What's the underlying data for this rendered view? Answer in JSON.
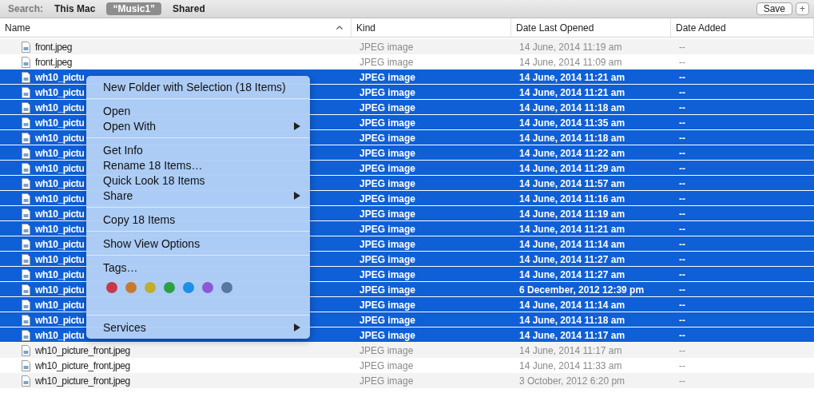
{
  "search_bar": {
    "label": "Search:",
    "scopes": [
      {
        "label": "This Mac",
        "selected": false
      },
      {
        "label": "“Music1”",
        "selected": true
      },
      {
        "label": "Shared",
        "selected": false
      }
    ],
    "save_button": "Save",
    "add_button": "+"
  },
  "table": {
    "columns": [
      {
        "label": "Name",
        "sorted": true
      },
      {
        "label": "Kind",
        "sorted": false
      },
      {
        "label": "Date Last Opened",
        "sorted": false
      },
      {
        "label": "Date Added",
        "sorted": false
      }
    ],
    "rows": [
      {
        "name": "front.jpeg",
        "kind": "JPEG image",
        "date_last_opened": "14 June, 2014 11:19 am",
        "date_added": "--",
        "selected": false
      },
      {
        "name": "front.jpeg",
        "kind": "JPEG image",
        "date_last_opened": "14 June, 2014 11:09 am",
        "date_added": "--",
        "selected": false
      },
      {
        "name": "wh10_pictu",
        "kind": "JPEG image",
        "date_last_opened": "14 June, 2014 11:21 am",
        "date_added": "--",
        "selected": true
      },
      {
        "name": "wh10_pictu",
        "kind": "JPEG image",
        "date_last_opened": "14 June, 2014 11:21 am",
        "date_added": "--",
        "selected": true
      },
      {
        "name": "wh10_pictu",
        "kind": "JPEG image",
        "date_last_opened": "14 June, 2014 11:18 am",
        "date_added": "--",
        "selected": true
      },
      {
        "name": "wh10_pictu",
        "kind": "JPEG image",
        "date_last_opened": "14 June, 2014 11:35 am",
        "date_added": "--",
        "selected": true
      },
      {
        "name": "wh10_pictu",
        "kind": "JPEG image",
        "date_last_opened": "14 June, 2014 11:18 am",
        "date_added": "--",
        "selected": true
      },
      {
        "name": "wh10_pictu",
        "kind": "JPEG image",
        "date_last_opened": "14 June, 2014 11:22 am",
        "date_added": "--",
        "selected": true
      },
      {
        "name": "wh10_pictu",
        "kind": "JPEG image",
        "date_last_opened": "14 June, 2014 11:29 am",
        "date_added": "--",
        "selected": true
      },
      {
        "name": "wh10_pictu",
        "kind": "JPEG image",
        "date_last_opened": "14 June, 2014 11:57 am",
        "date_added": "--",
        "selected": true
      },
      {
        "name": "wh10_pictu",
        "kind": "JPEG image",
        "date_last_opened": "14 June, 2014 11:16 am",
        "date_added": "--",
        "selected": true
      },
      {
        "name": "wh10_pictu",
        "kind": "JPEG image",
        "date_last_opened": "14 June, 2014 11:19 am",
        "date_added": "--",
        "selected": true
      },
      {
        "name": "wh10_pictu",
        "kind": "JPEG image",
        "date_last_opened": "14 June, 2014 11:21 am",
        "date_added": "--",
        "selected": true
      },
      {
        "name": "wh10_pictu",
        "kind": "JPEG image",
        "date_last_opened": "14 June, 2014 11:14 am",
        "date_added": "--",
        "selected": true
      },
      {
        "name": "wh10_pictu",
        "kind": "JPEG image",
        "date_last_opened": "14 June, 2014 11:27 am",
        "date_added": "--",
        "selected": true
      },
      {
        "name": "wh10_pictu",
        "kind": "JPEG image",
        "date_last_opened": "14 June, 2014 11:27 am",
        "date_added": "--",
        "selected": true
      },
      {
        "name": "wh10_pictu",
        "kind": "JPEG image",
        "date_last_opened": "6 December, 2012 12:39 pm",
        "date_added": "--",
        "selected": true
      },
      {
        "name": "wh10_pictu",
        "kind": "JPEG image",
        "date_last_opened": "14 June, 2014 11:14 am",
        "date_added": "--",
        "selected": true
      },
      {
        "name": "wh10_pictu",
        "kind": "JPEG image",
        "date_last_opened": "14 June, 2014 11:18 am",
        "date_added": "--",
        "selected": true
      },
      {
        "name": "wh10_pictu",
        "kind": "JPEG image",
        "date_last_opened": "14 June, 2014 11:17 am",
        "date_added": "--",
        "selected": true
      },
      {
        "name": "wh10_picture_front.jpeg",
        "kind": "JPEG image",
        "date_last_opened": "14 June, 2014 11:17 am",
        "date_added": "--",
        "selected": false
      },
      {
        "name": "wh10_picture_front.jpeg",
        "kind": "JPEG image",
        "date_last_opened": "14 June, 2014 11:33 am",
        "date_added": "--",
        "selected": false
      },
      {
        "name": "wh10_picture_front.jpeg",
        "kind": "JPEG image",
        "date_last_opened": "3 October, 2012 6:20 pm",
        "date_added": "--",
        "selected": false
      }
    ]
  },
  "context_menu": {
    "items": [
      {
        "kind": "item",
        "label": "New Folder with Selection (18 Items)",
        "submenu": false
      },
      {
        "kind": "separator"
      },
      {
        "kind": "item",
        "label": "Open",
        "submenu": false
      },
      {
        "kind": "item",
        "label": "Open With",
        "submenu": true
      },
      {
        "kind": "separator"
      },
      {
        "kind": "item",
        "label": "Get Info",
        "submenu": false
      },
      {
        "kind": "item",
        "label": "Rename 18 Items…",
        "submenu": false
      },
      {
        "kind": "item",
        "label": "Quick Look 18 Items",
        "submenu": false
      },
      {
        "kind": "item",
        "label": "Share",
        "submenu": true
      },
      {
        "kind": "separator"
      },
      {
        "kind": "item",
        "label": "Copy 18 Items",
        "submenu": false
      },
      {
        "kind": "separator"
      },
      {
        "kind": "item",
        "label": "Show View Options",
        "submenu": false
      },
      {
        "kind": "separator"
      },
      {
        "kind": "item",
        "label": "Tags…",
        "submenu": false
      },
      {
        "kind": "tags",
        "colors": [
          {
            "color": "#c8374a"
          },
          {
            "color": "#c57b2e"
          },
          {
            "color": "#bfae2f"
          },
          {
            "color": "#2ea044"
          },
          {
            "color": "#1e8ee8"
          },
          {
            "color": "#8e57d8"
          },
          {
            "color": "#5a76a0"
          }
        ]
      },
      {
        "kind": "separator"
      },
      {
        "kind": "item",
        "label": "Services",
        "submenu": true
      }
    ]
  }
}
